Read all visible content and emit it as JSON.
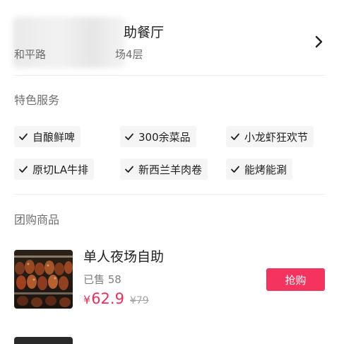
{
  "store": {
    "name_visible": "助餐厅",
    "address_left": "和平路",
    "address_right": "场4层"
  },
  "features": {
    "title": "特色服务",
    "tags": [
      "自酿鲜啤",
      "300余菜品",
      "小龙虾狂欢节",
      "原切LA牛排",
      "新西兰羊肉卷",
      "能烤能涮"
    ]
  },
  "group_buy": {
    "title": "团购商品",
    "items": [
      {
        "title": "单人夜场自助",
        "sold": "已售 58",
        "currency": "¥",
        "price": "62.9",
        "original_price": "¥79",
        "button": "抢购"
      }
    ]
  },
  "colors": {
    "accent": "#f4345f",
    "price": "#ef2f5a",
    "muted": "#808080",
    "divider": "#ececec",
    "tag_bg": "#f5f5f5"
  },
  "icons": {
    "header_nav": "chevron-right-icon",
    "tag_mark": "check-icon"
  }
}
